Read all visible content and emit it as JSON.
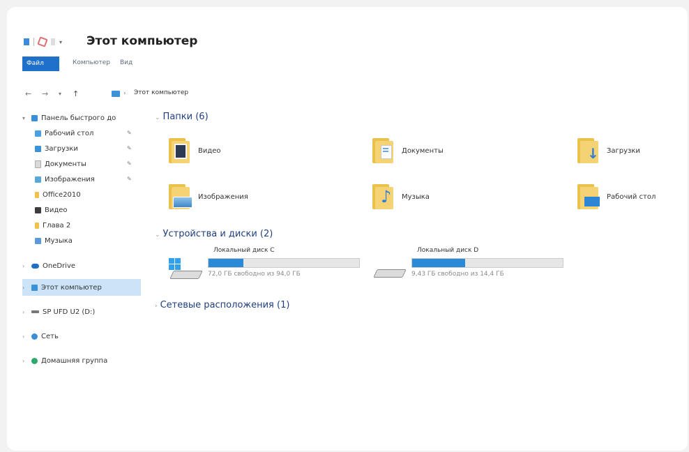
{
  "window": {
    "title": "Этот компьютер"
  },
  "ribbon": {
    "tabs": [
      "Файл",
      "Компьютер",
      "Вид"
    ]
  },
  "address": {
    "path": "Этот компьютер"
  },
  "navpane": {
    "items": [
      {
        "label": "Панель быстрого до",
        "icon": "star-icon"
      },
      {
        "label": "Рабочий стол",
        "icon": "desktop-folder-icon"
      },
      {
        "label": "Загрузки",
        "icon": "downloads-folder-icon"
      },
      {
        "label": "Документы",
        "icon": "documents-folder-icon"
      },
      {
        "label": "Изображения",
        "icon": "pictures-folder-icon"
      },
      {
        "label": "Office2010",
        "icon": "folder-icon"
      },
      {
        "label": "Видео",
        "icon": "videos-folder-icon"
      },
      {
        "label": "Глава 2",
        "icon": "folder-icon"
      },
      {
        "label": "Музыка",
        "icon": "music-folder-icon"
      },
      {
        "label": "OneDrive",
        "icon": "onedrive-icon"
      },
      {
        "label": "Этот компьютер",
        "icon": "this-pc-icon"
      },
      {
        "label": "SP UFD U2 (D:)",
        "icon": "usb-drive-icon"
      },
      {
        "label": "Сеть",
        "icon": "network-icon"
      },
      {
        "label": "Домашняя группа",
        "icon": "homegroup-icon"
      }
    ]
  },
  "sections": {
    "folders_title": "Папки (6)",
    "devices_title": "Устройства и диски (2)",
    "network_title": "Сетевые расположения (1)"
  },
  "folders": [
    {
      "label": "Видео",
      "icon": "videos-folder-icon"
    },
    {
      "label": "Документы",
      "icon": "documents-folder-icon"
    },
    {
      "label": "Загрузки",
      "icon": "downloads-folder-icon"
    },
    {
      "label": "Изображения",
      "icon": "pictures-folder-icon"
    },
    {
      "label": "Музыка",
      "icon": "music-folder-icon"
    },
    {
      "label": "Рабочий стол",
      "icon": "desktop-folder-icon"
    }
  ],
  "drives": [
    {
      "name": "Локальный диск C",
      "free": "72,0 ГБ свободно из 94,0 ГБ",
      "used_fraction": 0.23,
      "icon": "windows-drive-icon"
    },
    {
      "name": "Локальный диск D",
      "free": "9,43 ГБ свободно из 14,4 ГБ",
      "used_fraction": 0.35,
      "icon": "hard-drive-icon"
    }
  ],
  "colors": {
    "accent": "#1f70c8",
    "drive_bar": "#2a8ad8",
    "section_title": "#1e3f82",
    "selection": "#cce4f7"
  }
}
